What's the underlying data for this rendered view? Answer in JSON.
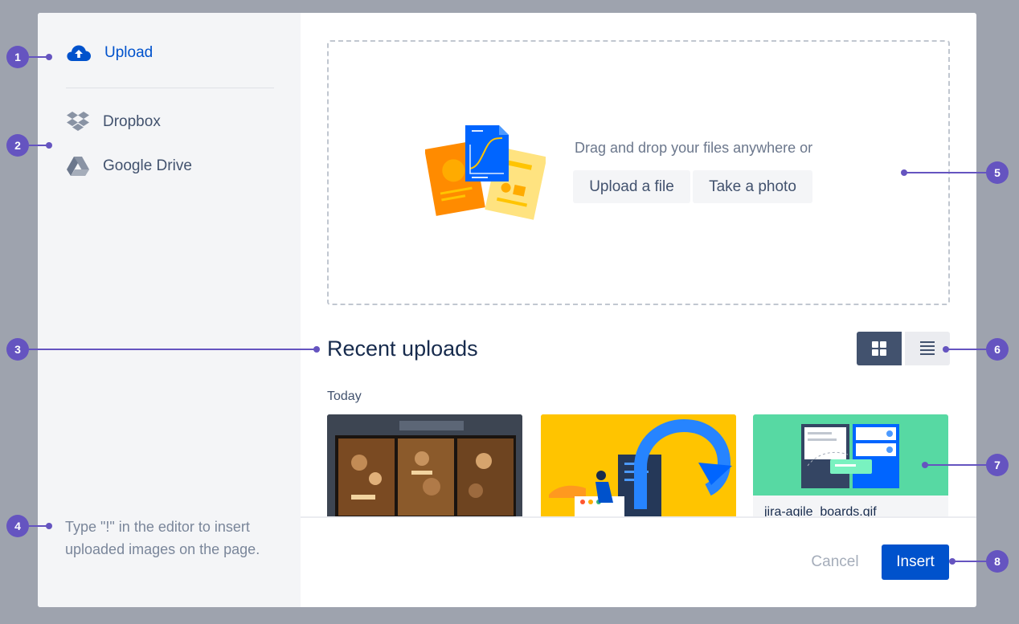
{
  "sidebar": {
    "upload_label": "Upload",
    "items": [
      {
        "label": "Dropbox",
        "icon": "dropbox-icon"
      },
      {
        "label": "Google Drive",
        "icon": "google-drive-icon"
      }
    ],
    "hint": "Type \"!\" in the editor to insert uploaded images on the page."
  },
  "dropzone": {
    "text": "Drag and drop your files anywhere or",
    "upload_button": "Upload a file",
    "photo_button": "Take a photo"
  },
  "recent": {
    "title": "Recent uploads",
    "group_label": "Today",
    "cards": [
      {
        "name": "",
        "thumbnail": "cafe-photo"
      },
      {
        "name": "",
        "thumbnail": "yellow-illustration"
      },
      {
        "name": "jira-agile_boards.gif",
        "thumbnail": "boards-illustration"
      }
    ]
  },
  "footer": {
    "cancel_label": "Cancel",
    "insert_label": "Insert"
  },
  "callouts": [
    "1",
    "2",
    "3",
    "4",
    "5",
    "6",
    "7",
    "8"
  ],
  "colors": {
    "accent": "#0052cc",
    "callout": "#6554c0",
    "backdrop": "#9ea3ae"
  }
}
